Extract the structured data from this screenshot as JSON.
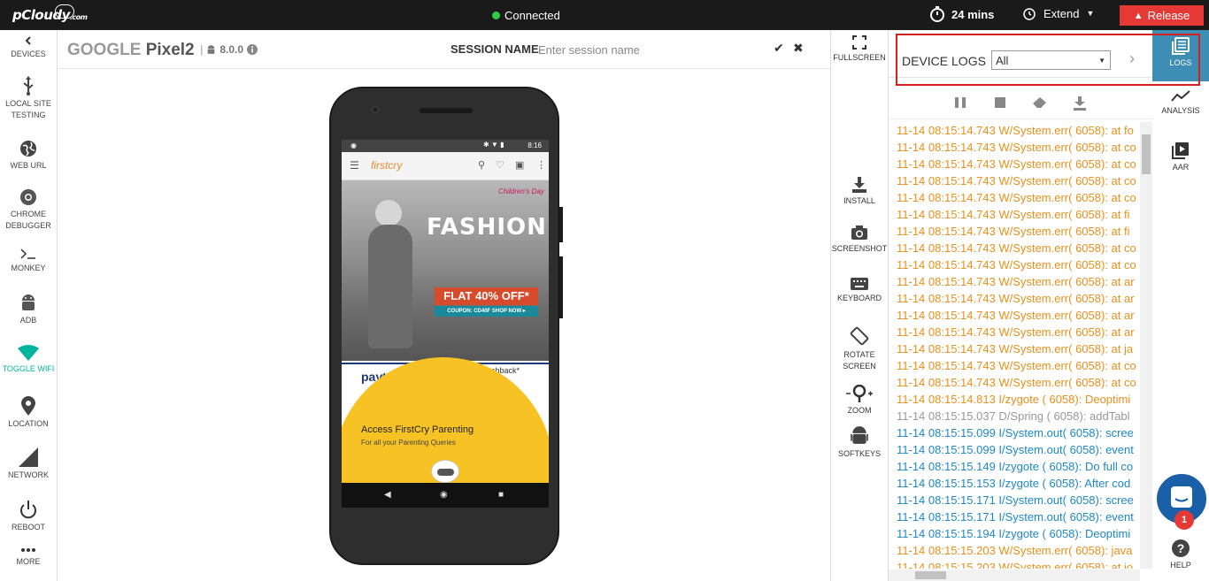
{
  "brand": {
    "logo": "pCloudy",
    "logo_suffix": ".com"
  },
  "topbar": {
    "status": "Connected",
    "timer": "24 mins",
    "extend": "Extend",
    "release": "Release"
  },
  "sidebar": {
    "items": [
      {
        "label": "DEVICES",
        "icon": "chevron-left-icon"
      },
      {
        "label": "LOCAL SITE\nTESTING",
        "icon": "usb-icon"
      },
      {
        "label": "WEB URL",
        "icon": "globe-icon"
      },
      {
        "label": "CHROME\nDEBUGGER",
        "icon": "chrome-icon"
      },
      {
        "label": "MONKEY",
        "icon": "terminal-icon"
      },
      {
        "label": "ADB",
        "icon": "android-icon"
      },
      {
        "label": "TOGGLE WIFI",
        "icon": "wifi-icon"
      },
      {
        "label": "LOCATION",
        "icon": "location-icon"
      },
      {
        "label": "NETWORK",
        "icon": "signal-icon"
      },
      {
        "label": "REBOOT",
        "icon": "power-icon"
      },
      {
        "label": "MORE",
        "icon": "more-icon"
      }
    ]
  },
  "device": {
    "brand": "GOOGLE",
    "model": "Pixel2",
    "version": "8.0.0"
  },
  "session": {
    "label": "SESSION NAME",
    "placeholder": "Enter session name"
  },
  "phone_screen": {
    "time": "8:16",
    "app_logo": "firstcry",
    "banner_tag": "Children's Day",
    "banner_title": "FASHION",
    "offer": "FLAT 40% OFF*",
    "coupon": "COUPON: CD40F   SHOP NOW ▸",
    "paytm": "paytm",
    "cashback": "Up to 10% cashback*",
    "popup_title": "Access FirstCry Parenting",
    "popup_sub": "For all your Parenting Queries"
  },
  "tools": {
    "fullscreen": "FULLSCREEN",
    "install": "INSTALL",
    "screenshot": "SCREENSHOT",
    "keyboard": "KEYBOARD",
    "rotate": "ROTATE\nSCREEN",
    "zoom": "ZOOM",
    "softkeys": "SOFTKEYS"
  },
  "logs": {
    "title": "DEVICE LOGS",
    "filter": "All",
    "lines": [
      {
        "text": "11-14 08:15:14.743 W/System.err( 6058): at fo",
        "level": "warn"
      },
      {
        "text": "11-14 08:15:14.743 W/System.err( 6058): at co",
        "level": "warn"
      },
      {
        "text": "11-14 08:15:14.743 W/System.err( 6058): at co",
        "level": "warn"
      },
      {
        "text": "11-14 08:15:14.743 W/System.err( 6058): at co",
        "level": "warn"
      },
      {
        "text": "11-14 08:15:14.743 W/System.err( 6058): at co",
        "level": "warn"
      },
      {
        "text": "11-14 08:15:14.743 W/System.err( 6058): at fi",
        "level": "warn"
      },
      {
        "text": "11-14 08:15:14.743 W/System.err( 6058): at fi",
        "level": "warn"
      },
      {
        "text": "11-14 08:15:14.743 W/System.err( 6058): at co",
        "level": "warn"
      },
      {
        "text": "11-14 08:15:14.743 W/System.err( 6058): at co",
        "level": "warn"
      },
      {
        "text": "11-14 08:15:14.743 W/System.err( 6058): at ar",
        "level": "warn"
      },
      {
        "text": "11-14 08:15:14.743 W/System.err( 6058): at ar",
        "level": "warn"
      },
      {
        "text": "11-14 08:15:14.743 W/System.err( 6058): at ar",
        "level": "warn"
      },
      {
        "text": "11-14 08:15:14.743 W/System.err( 6058): at ar",
        "level": "warn"
      },
      {
        "text": "11-14 08:15:14.743 W/System.err( 6058): at ja",
        "level": "warn"
      },
      {
        "text": "11-14 08:15:14.743 W/System.err( 6058): at co",
        "level": "warn"
      },
      {
        "text": "11-14 08:15:14.743 W/System.err( 6058): at co",
        "level": "warn"
      },
      {
        "text": "11-14 08:15:14.813 I/zygote ( 6058): Deoptimi",
        "level": "warn"
      },
      {
        "text": "11-14 08:15:15.037 D/Spring ( 6058): addTabl",
        "level": "debug"
      },
      {
        "text": "11-14 08:15:15.099 I/System.out( 6058): scree",
        "level": "info"
      },
      {
        "text": "11-14 08:15:15.099 I/System.out( 6058): event",
        "level": "info"
      },
      {
        "text": "11-14 08:15:15.149 I/zygote ( 6058): Do full co",
        "level": "info"
      },
      {
        "text": "11-14 08:15:15.153 I/zygote ( 6058): After cod",
        "level": "info"
      },
      {
        "text": "11-14 08:15:15.171 I/System.out( 6058): scree",
        "level": "info"
      },
      {
        "text": "11-14 08:15:15.171 I/System.out( 6058): event",
        "level": "info"
      },
      {
        "text": "11-14 08:15:15.194 I/zygote ( 6058): Deoptimi",
        "level": "info"
      },
      {
        "text": "11-14 08:15:15.203 W/System.err( 6058): java",
        "level": "warn"
      },
      {
        "text": "11-14 08:15:15.203 W/System.err( 6058): at jo",
        "level": "warn"
      }
    ]
  },
  "rightnav": {
    "logs": "LOGS",
    "analysis": "ANALYSIS",
    "aar": "AAR",
    "help": "HELP",
    "chat_badge": "1"
  },
  "colors": {
    "accent_teal": "#00b5a0",
    "release_red": "#e53935",
    "logs_active": "#3d8db5",
    "warn": "#e8901c",
    "info": "#1e88c9"
  }
}
